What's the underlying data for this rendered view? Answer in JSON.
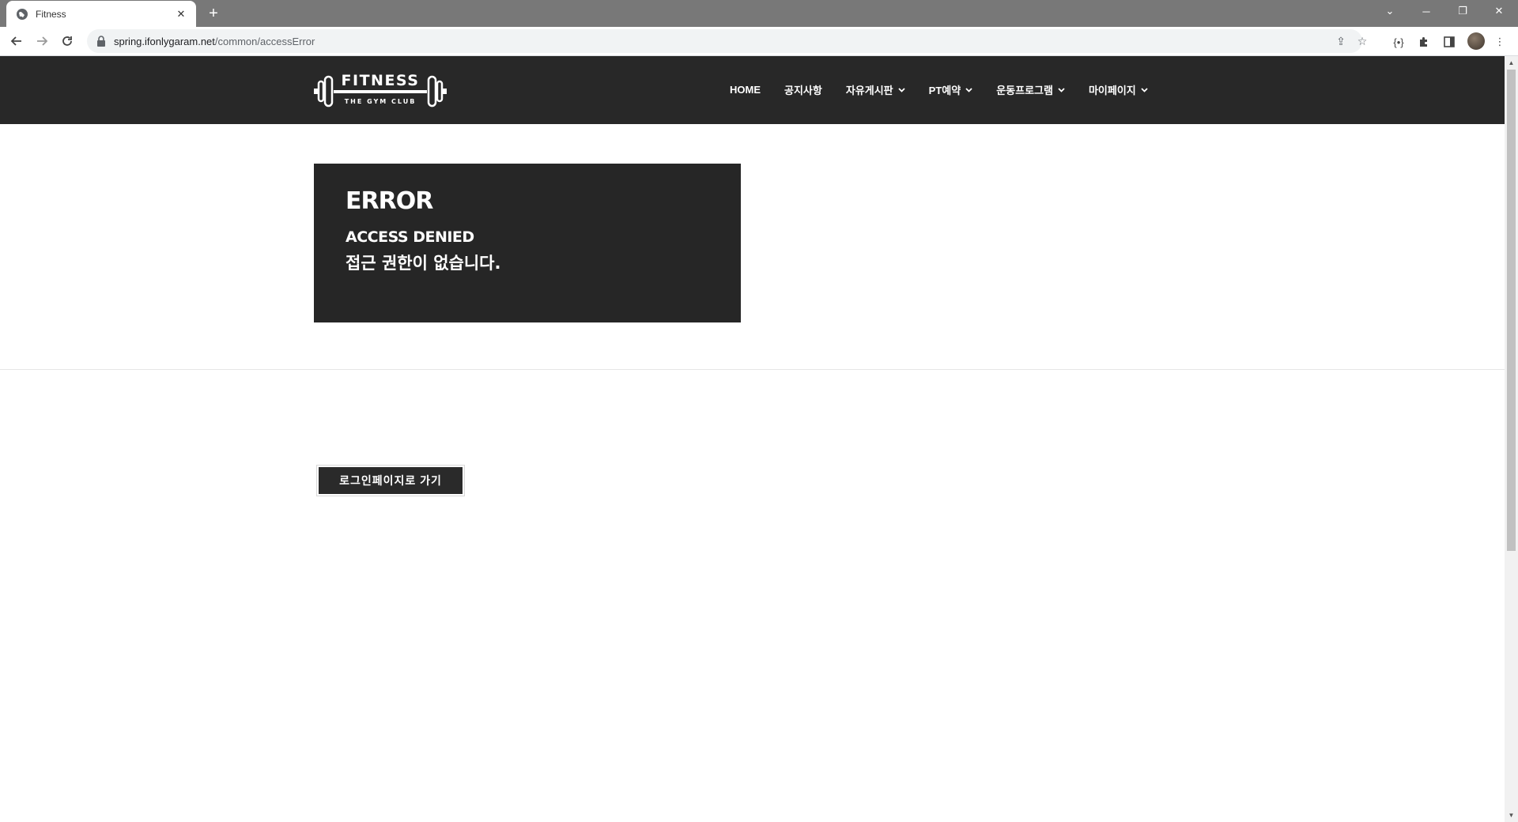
{
  "browser": {
    "tab_title": "Fitness",
    "url_host": "spring.ifonlygaram.net",
    "url_path": "/common/accessError"
  },
  "site": {
    "logo_text": "FITNESS",
    "logo_subtext": "THE GYM CLUB",
    "nav": [
      {
        "label": "HOME",
        "has_dropdown": false
      },
      {
        "label": "공지사항",
        "has_dropdown": false
      },
      {
        "label": "자유게시판",
        "has_dropdown": true
      },
      {
        "label": "PT예약",
        "has_dropdown": true
      },
      {
        "label": "운동프로그램",
        "has_dropdown": true
      },
      {
        "label": "마이페이지",
        "has_dropdown": true
      }
    ]
  },
  "error": {
    "title": "ERROR",
    "subtitle": "ACCESS DENIED",
    "message": "접근 권한이 없습니다."
  },
  "actions": {
    "login_button": "로그인페이지로 가기"
  },
  "colors": {
    "header_bg": "#282828",
    "error_bg": "#262626",
    "tabstrip_bg": "#787878"
  }
}
